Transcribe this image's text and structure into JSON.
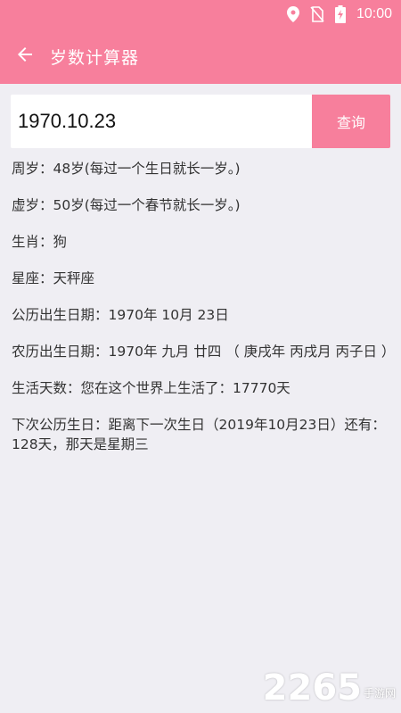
{
  "status_bar": {
    "time": "10:00",
    "icons": [
      "location-icon",
      "no-sim-icon",
      "battery-charging-icon"
    ]
  },
  "app_bar": {
    "title": "岁数计算器",
    "back_icon": "arrow-left-icon"
  },
  "search": {
    "value": "1970.10.23",
    "button_label": "查询"
  },
  "results": {
    "zhousui": "周岁：48岁(每过一个生日就长一岁。)",
    "xusui": "虚岁：50岁(每过一个春节就长一岁。)",
    "shengxiao": "生肖：狗",
    "xingzuo": "星座：天秤座",
    "gongli": "公历出生日期：1970年 10月 23日",
    "nongli": "农历出生日期：1970年 九月 廿四 （ 庚戌年 丙戌月 丙子日 ）",
    "days_lived": "生活天数：您在这个世界上生活了：17770天",
    "next_birthday": "下次公历生日：距离下一次生日（2019年10月23日）还有：128天，那天是星期三"
  },
  "watermark": {
    "number": "2265",
    "text": "手游网"
  },
  "colors": {
    "accent": "#f77f9c",
    "background": "#efeef3"
  }
}
